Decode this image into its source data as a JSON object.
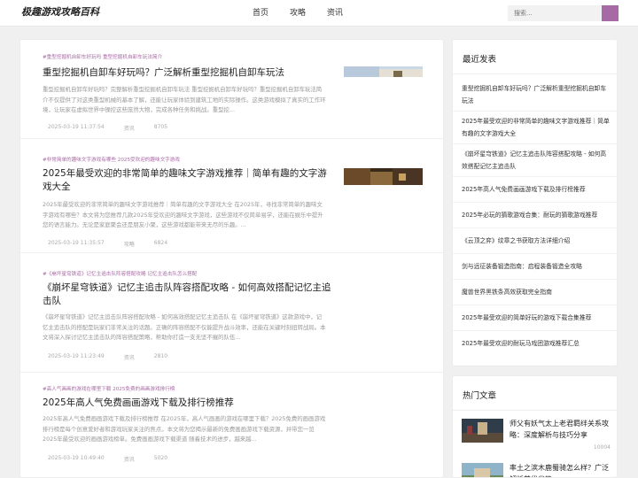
{
  "header": {
    "logo": "极趣游戏攻略百科",
    "nav": [
      "首页",
      "攻略",
      "资讯"
    ],
    "search_placeholder": "搜索..."
  },
  "articles": [
    {
      "tags": "#重型挖掘机自卸车好玩吗 重型挖掘机自卸车玩法简介",
      "title": "重型挖掘机自卸车好玩吗？广泛解析重型挖掘机自卸车玩法",
      "excerpt": "重型挖掘机自卸车好玩吗？完整解析重型挖掘机自卸车玩法 重型挖掘机自卸车好玩吗？重型挖掘机自卸车玩法简介不仅提供了对这类重型机械的基本了解，还能让玩家体验到建筑工地的实际操作。这类游戏模拟了真实的工作环境，让玩家在虚拟世界中操控这些庞然大物，完成各种任务和挑战。重型挖...",
      "date": "2025-03-19 11:37:54",
      "category": "资讯",
      "views": "8705"
    },
    {
      "tags": "#非常简单的趣味文字游戏有哪些 2025受欢迎的趣味文字游戏",
      "title": "2025年最受欢迎的非常简单的趣味文字游戏推荐｜简单有趣的文字游戏大全",
      "excerpt": "2025年最受欢迎的非常简单的趣味文字游戏推荐｜简单有趣的文字游戏大全 在2025年，寻找非常简单的趣味文字游戏有哪些？本文将为您推荐几款2025年受欢迎的趣味文字游戏，这些游戏不仅简单易学，还能在娱乐中提升您的语言能力。无论是家庭聚会还是朋友小聚，这些游戏都能带来无尽的乐趣。...",
      "date": "2025-03-19 11:35:57",
      "category": "攻略",
      "views": "6824"
    },
    {
      "tags": "#《崩坏星穹铁道》记忆主追击队阵容搭配攻略 记忆主追击队怎么搭配",
      "title": "《崩坏星穹铁道》记忆主追击队阵容搭配攻略 - 如何高效搭配记忆主追击队",
      "excerpt": "《崩坏星穹铁道》记忆主追击队阵容搭配攻略 - 如何高效搭配记忆主追击队 在《崩坏星穹铁道》这款游戏中，记忆主追击队的搭配是玩家们非常关注的话题。正确的阵容搭配不仅能提升战斗效率，还能在关键时刻扭转战局。本文将深入探讨记忆主追击队的阵容搭配策略，帮助你打造一支无坚不摧的队伍...",
      "date": "2025-03-19 11:23:49",
      "category": "资讯",
      "views": "2810"
    },
    {
      "tags": "#高人气画画的游戏在哪里下载 2025免费的画画游戏排行榜",
      "title": "2025年高人气免费画画游戏下载及排行榜推荐",
      "excerpt": "2025年高人气免费画画游戏下载及排行榜推荐 在2025年，高人气画画的游戏在哪里下载？2025免费的画画游戏排行榜是每个创意爱好者和游戏玩家关注的焦点。本文将为您揭示最新的免费画画游戏下载资源，并带您一览2025年最受欢迎的画画游戏榜单。免费画画游戏下载渠道 随着技术的进步，越来越...",
      "date": "2025-03-19 10:49:40",
      "category": "资讯",
      "views": "5020"
    }
  ],
  "sidebar": {
    "recent_title": "最近发表",
    "recent": [
      "重型挖掘机自卸车好玩吗？广泛解析重型挖掘机自卸车玩法",
      "2025年最受欢迎的非常简单的趣味文字游戏推荐｜简单有趣的文字游戏大全",
      "《崩坏星穹铁道》记忆主追击队阵容搭配攻略 - 如何高效搭配记忆主追击队",
      "2025年高人气免费画画游戏下载及排行榜推荐",
      "2025年必玩的猜歌游戏合集：耐玩的猜歌游戏推荐",
      "《云顶之弈》纹章之书获取方法详细介绍",
      "剑与远征装备锻造指南：启程装备锻造全攻略",
      "魔兽世界黑铁条高效获取完全指南",
      "2025年最受欢迎的简单好玩的游戏下载合集推荐",
      "2025年最受欢迎的耐玩马戏团游戏推荐汇总"
    ],
    "hot_title": "热门文章",
    "hot": [
      {
        "title": "师父有妖气太上老君羁绊关系攻略：深度解析与技巧分享",
        "views": "10004"
      },
      {
        "title": "率土之滨木鹿蜀骑怎么样？广泛解析其优劣势",
        "views": ""
      }
    ]
  }
}
